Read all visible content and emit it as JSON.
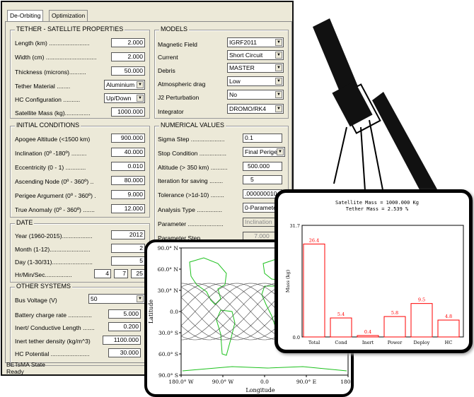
{
  "tabs": [
    "De-Orbiting",
    "Optimization"
  ],
  "tether": {
    "title": "TETHER - SATELLITE PROPERTIES",
    "length_label": "Length (km) ........................",
    "length_value": "2.000",
    "width_label": "Width (cm) ..............................",
    "width_value": "2.000",
    "thickness_label": "Thickness (microns)..........",
    "thickness_value": "50.000",
    "material_label": "Tether Material ........",
    "material_value": "Aluminium",
    "hc_config_label": "HC Configuration ..........",
    "hc_config_value": "Up/Down",
    "mass_label": "Satellite Mass (kg)...............",
    "mass_value": "1000.000"
  },
  "models": {
    "title": "MODELS",
    "magnetic_label": "Magnetic Field",
    "magnetic_value": "IGRF2011",
    "current_label": "Current",
    "current_value": "Short Circuit",
    "debris_label": "Debris",
    "debris_value": "MASTER",
    "drag_label": "Atmospheric drag",
    "drag_value": "Low",
    "j2_label": "J2 Perturbation",
    "j2_value": "No",
    "integrator_label": "Integrator",
    "integrator_value": "DROMO/RK4"
  },
  "initial": {
    "title": "INITIAL CONDITIONS",
    "apogee_label": "Apogee Altitude   (<1500 km)",
    "apogee_value": "900.000",
    "inclination_label": "Inclination (0º -180º) .........",
    "inclination_value": "40.000",
    "ecc_label": "Eccentricity (0 - 1) ............",
    "ecc_value": "0.010",
    "node_label": "Ascending Node (0º - 360º) ..",
    "node_value": "80.000",
    "perigee_label": "Perigee Argument (0º - 360º) .",
    "perigee_value": "9.000",
    "anomaly_label": "True Anomaly (0º - 360º) .......",
    "anomaly_value": "12.000"
  },
  "numerical": {
    "title": "NUMERICAL VALUES",
    "sigma_label": "Sigma Step ....................",
    "sigma_value": "0.1",
    "stop_label": "Stop Condition ................",
    "stop_value": "Final Perigee",
    "altitude_label": "Altitude (> 350 km) ..........",
    "altitude_value": "500.000",
    "iter_label": "Iteration for saving ........",
    "iter_value": "5",
    "tol_label": "Tolerance (>1d-10) ........",
    "tol_value": ".000000010",
    "analysis_label": "Analysis Type ...............",
    "analysis_value": "0-Parameter",
    "param_label": "Parameter .....................",
    "param_value": "Inclination",
    "pstep_label": "Parameter Step ..............",
    "pstep_value": "7.000"
  },
  "date": {
    "title": "DATE",
    "year_label": "Year (1960-2015)..................",
    "year_value": "2012",
    "month_label": "Month (1-12)........................",
    "month_value": "2",
    "day_label": "Day (1-30/31)........................",
    "day_value": "5",
    "time_label": "Hr/Min/Sec................",
    "hr_value": "4",
    "min_value": "7",
    "sec_value": "25"
  },
  "other": {
    "title": "OTHER SYSTEMS",
    "bus_label": "Bus Voltage (V)",
    "bus_value": "50",
    "battery_label": "Battery charge rate ..............",
    "battery_value": "5.000",
    "inert_len_label": "Inert/ Conductive Length .......",
    "inert_len_value": "0.200",
    "density_label": "Inert tether density (kg/m^3)",
    "density_value": "1100.000",
    "hc_label": "HC Potential .......................",
    "hc_value": "30.000"
  },
  "status": {
    "title": "BETsMA State",
    "value": "Ready"
  },
  "map": {
    "y_ticks": [
      "90.0° N",
      "60.0° N",
      "30.0° N",
      "0.0",
      "30.0° S",
      "60.0° S",
      "90.0° S"
    ],
    "x_ticks": [
      "180.0° W",
      "90.0° W",
      "0.0",
      "90.0° E",
      "180.0"
    ],
    "xlabel": "Longitude",
    "ylabel": "Latitude"
  },
  "chart_data": {
    "type": "bar",
    "title": "Satellite Mass =  1000.000 Kg",
    "subtitle": "Tether Mass =    2.539 %",
    "categories": [
      "Total",
      "Cond",
      "Inert",
      "Power",
      "Deploy",
      "HC"
    ],
    "values": [
      26.4,
      5.4,
      0.4,
      5.8,
      9.5,
      4.8
    ],
    "value_labels": [
      "26.4",
      "5.4",
      "0.4",
      "5.8",
      "9.5",
      "4.8"
    ],
    "ylabel": "Mass (kg)",
    "y_ticks": [
      "31.7",
      "0.0"
    ],
    "ylim": [
      0,
      31.7
    ],
    "bar_color": "#ff0000"
  }
}
